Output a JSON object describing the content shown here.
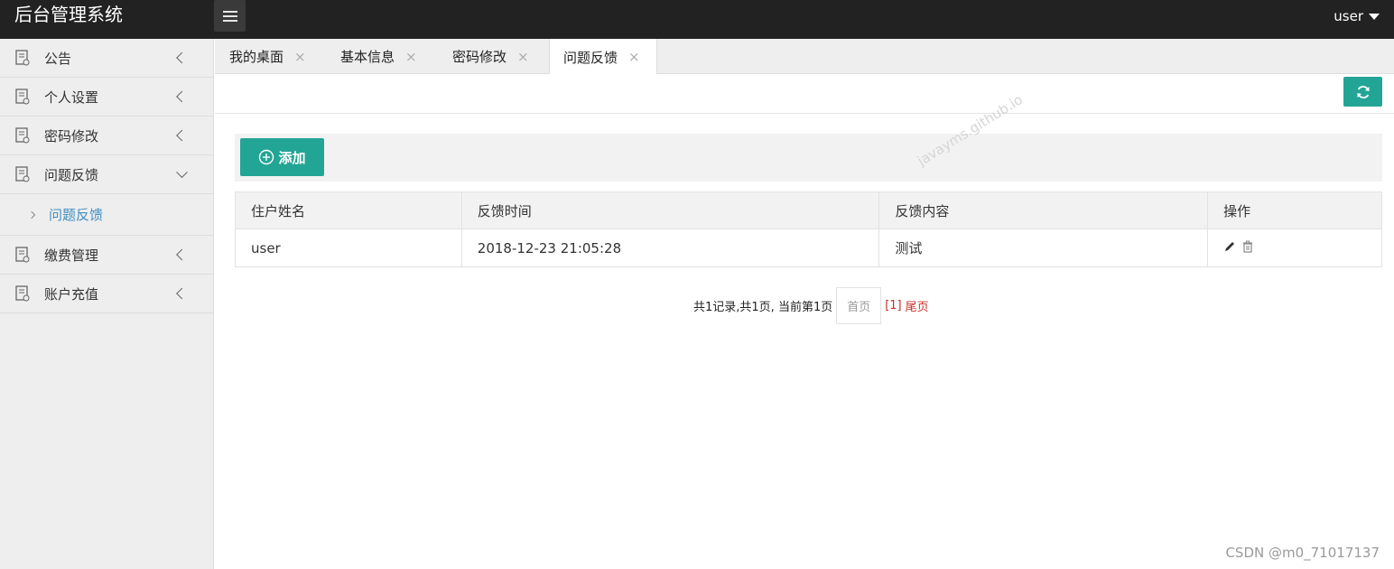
{
  "header": {
    "title": "后台管理系统",
    "user": "user"
  },
  "sidebar": {
    "items": [
      {
        "label": "公告"
      },
      {
        "label": "个人设置"
      },
      {
        "label": "密码修改"
      },
      {
        "label": "问题反馈"
      },
      {
        "label": "缴费管理"
      },
      {
        "label": "账户充值"
      }
    ],
    "subitems": [
      {
        "label": "问题反馈"
      }
    ]
  },
  "tabs": [
    {
      "label": "我的桌面",
      "close": "×"
    },
    {
      "label": "基本信息",
      "close": "×"
    },
    {
      "label": "密码修改",
      "close": "×"
    },
    {
      "label": "问题反馈",
      "close": "×"
    }
  ],
  "actions": {
    "add_label": "添加"
  },
  "table": {
    "headers": [
      "住户姓名",
      "反馈时间",
      "反馈内容",
      "操作"
    ],
    "rows": [
      {
        "name": "user",
        "time": "2018-12-23 21:05:28",
        "content": "测试"
      }
    ]
  },
  "pager": {
    "summary": "共1记录,共1页, 当前第1页",
    "first": "首页",
    "current": "[1]",
    "last": "尾页"
  },
  "watermark": "javayms.github.io",
  "credit": "CSDN @m0_71017137",
  "colors": {
    "primary": "#23a596",
    "topbar": "#222222",
    "link": "#3f8ec1",
    "pager_active": "#c9302c"
  }
}
